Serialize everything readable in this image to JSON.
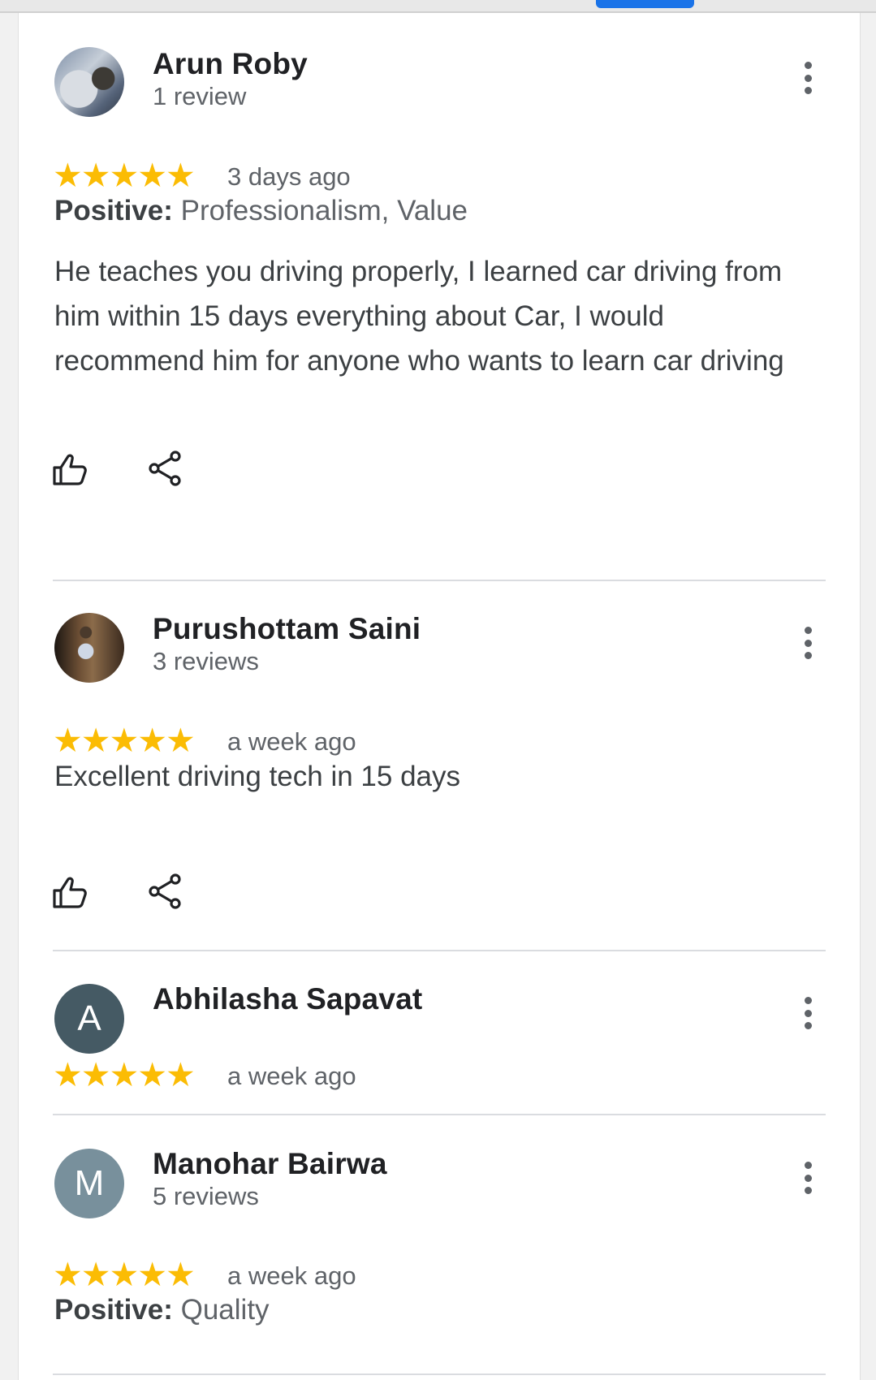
{
  "reviews": [
    {
      "name": "Arun Roby",
      "review_count": "1 review",
      "rating": 5,
      "stars": "★★★★★",
      "date": "3 days ago",
      "positive_label": "Positive:",
      "positive_values": " Professionalism, Value",
      "text": "He teaches you driving properly, I learned car driving from him within 15 days everything about Car, I would recommend him for anyone who wants to learn car driving"
    },
    {
      "name": "Purushottam Saini",
      "review_count": "3 reviews",
      "rating": 5,
      "stars": "★★★★★",
      "date": "a week ago",
      "text": "Excellent driving tech in 15 days"
    },
    {
      "name": "Abhilasha Sapavat",
      "avatar_letter": "A",
      "avatar_color": "#455a64",
      "rating": 5,
      "stars": "★★★★★",
      "date": "a week ago"
    },
    {
      "name": "Manohar Bairwa",
      "avatar_letter": "M",
      "avatar_color": "#78909c",
      "review_count": "5 reviews",
      "rating": 5,
      "stars": "★★★★★",
      "date": "a week ago",
      "positive_label": "Positive:",
      "positive_values": " Quality"
    }
  ],
  "colors": {
    "star": "#fbbc04",
    "accent_tab": "#1a73e8",
    "secondary_text": "#5f6368"
  },
  "icons": [
    "thumbs-up-icon",
    "share-icon",
    "more-vert-icon"
  ]
}
